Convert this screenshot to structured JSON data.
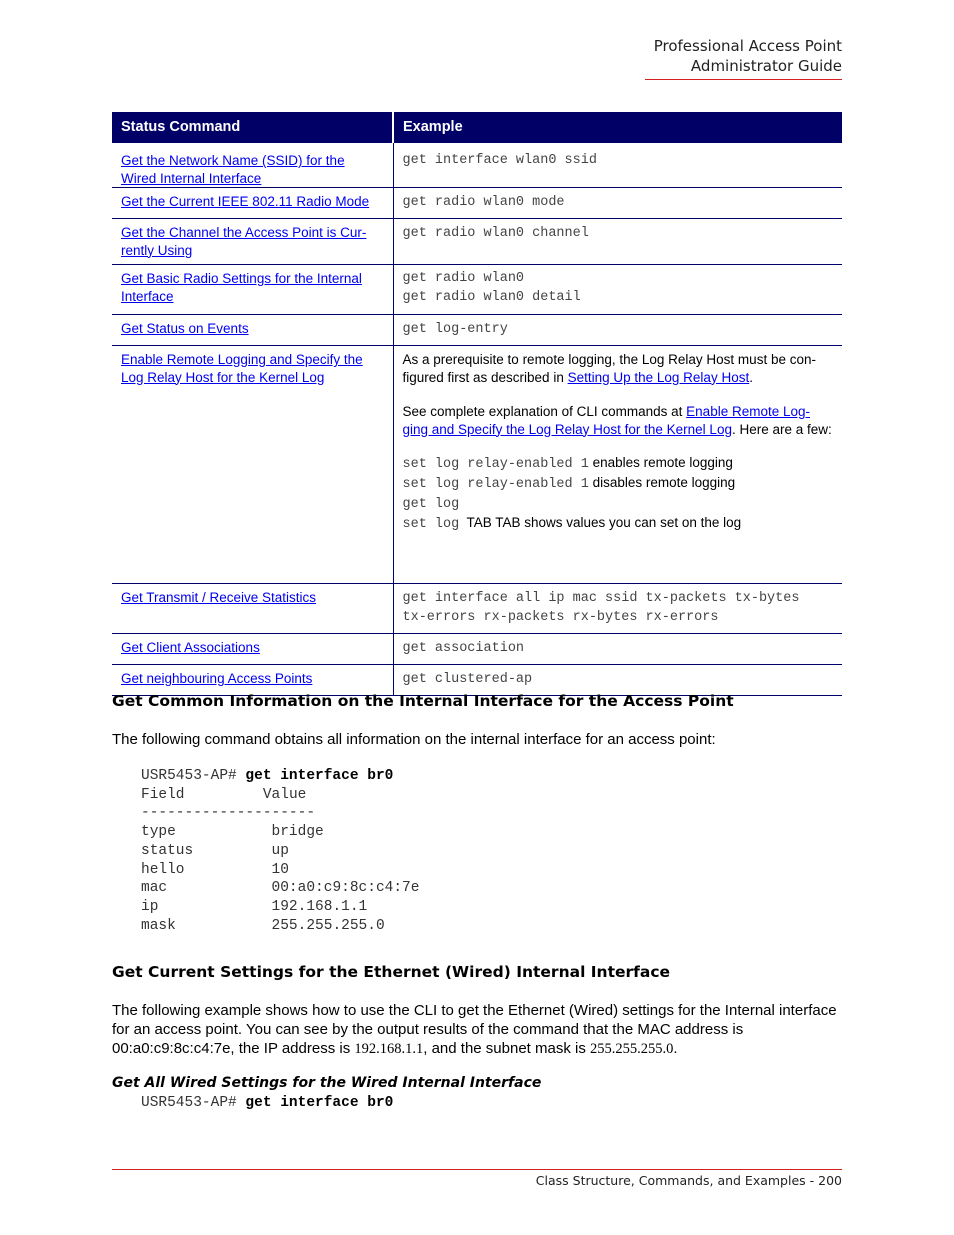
{
  "header": {
    "line1": "Professional Access Point",
    "line2": "Administrator Guide",
    "accent_color": "#d42020"
  },
  "table": {
    "header_color": "#000066",
    "columns": [
      "Status Command",
      "Example"
    ],
    "rows": [
      {
        "command": "Get the Network Name (SSID) for the Wired Internal Interface",
        "example_lines": [
          "get interface wlan0 ssid"
        ]
      },
      {
        "command": "Get the Current IEEE 802.11 Radio Mode",
        "example_lines": [
          "get radio wlan0 mode"
        ]
      },
      {
        "command": "Get the Channel the Access Point is Cur-rently Using",
        "example_lines": [
          "get radio wlan0 channel"
        ]
      },
      {
        "command": "Get Basic Radio Settings for the Internal Interface",
        "example_lines": [
          "get radio wlan0",
          "get radio wlan0 detail"
        ]
      },
      {
        "command": "Get Status on Events",
        "example_lines": [
          "get log-entry"
        ]
      },
      {
        "command": "Enable Remote Logging and Specify the Log Relay Host for the Kernel Log",
        "para1_pre": "As a prerequisite to remote logging, the Log Relay Host must be con-figured first as described in ",
        "para1_link": "Setting Up the Log Relay Host",
        "para1_post": ".",
        "para2_pre": "See complete explanation of CLI commands at ",
        "para2_link": "Enable Remote Log-ging and Specify the Log Relay Host for the Kernel Log",
        "para2_post": ". Here are a few:",
        "cmds": [
          {
            "code": "set log relay-enabled 1",
            "note": " enables remote logging"
          },
          {
            "code": "set log relay-enabled 1",
            "note": " disables remote logging"
          },
          {
            "code": "get log",
            "note": ""
          },
          {
            "code": "set log",
            "note": "  TAB TAB shows values you can set on the log"
          }
        ]
      },
      {
        "command": "Get Transmit / Receive Statistics",
        "example_lines": [
          "get interface all ip mac ssid tx-packets tx-bytes",
          "tx-errors rx-packets rx-bytes rx-errors"
        ]
      },
      {
        "command": "Get Client Associations",
        "example_lines": [
          "get association"
        ]
      },
      {
        "command": "Get neighbouring Access Points",
        "example_lines": [
          "get clustered-ap"
        ]
      }
    ]
  },
  "section1": {
    "heading": "Get Common Information on the Internal Interface for the Access Point",
    "intro": "The following command obtains all information on the internal interface for an access point:",
    "prompt": "USR5453-AP# ",
    "command": "get interface br0",
    "col_field": "Field",
    "col_value": "Value",
    "separator": "--------------------",
    "fields": [
      {
        "field": "type",
        "value": "bridge"
      },
      {
        "field": "status",
        "value": "up"
      },
      {
        "field": "hello",
        "value": "10"
      },
      {
        "field": "mac",
        "value": "00:a0:c9:8c:c4:7e"
      },
      {
        "field": "ip",
        "value": "192.168.1.1"
      },
      {
        "field": "mask",
        "value": "255.255.255.0"
      }
    ]
  },
  "section2": {
    "heading": "Get Current Settings for the Ethernet (Wired) Internal Interface",
    "para_a": "The following example shows how to use the CLI to get the Ethernet (Wired) settings for the Internal interface for an access point. You can see by the output results of the command that the MAC address is 00:a0:c9:8c:c4:7e, the IP address is ",
    "ip": "192.168.1.1",
    "para_b": ", and the subnet mask is ",
    "mask": "255.255.255.0",
    "para_c": ".",
    "subheading": "Get All Wired Settings for the Wired Internal Interface",
    "prompt": "USR5453-AP# ",
    "command": "get interface br0"
  },
  "footer": {
    "text": "Class Structure, Commands, and Examples - 200"
  }
}
